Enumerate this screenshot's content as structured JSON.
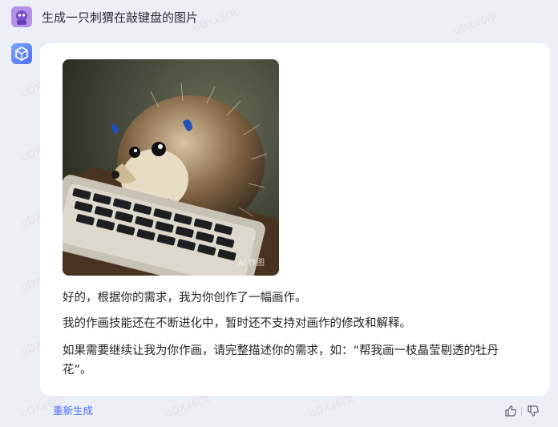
{
  "user": {
    "message": "生成一只刺猬在敲键盘的图片"
  },
  "bot": {
    "image_badge": "AI 作图",
    "paragraphs": [
      "好的，根据你的需求，我为你创作了一幅画作。",
      "我的作画技能还在不断进化中，暂时还不支持对画作的修改和解释。",
      "如果需要继续让我为你作画，请完整描述你的需求，如：“帮我画一枝晶莹剔透的牡丹花”。"
    ]
  },
  "actions": {
    "regenerate_label": "重新生成"
  },
  "watermark_text": "uDXx6lTc"
}
